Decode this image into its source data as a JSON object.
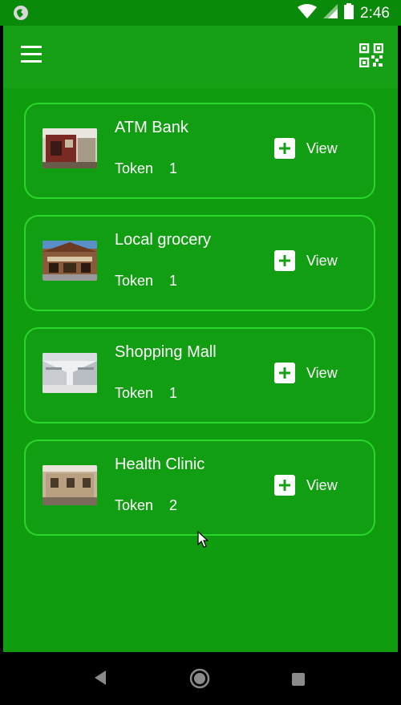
{
  "status_bar": {
    "time": "2:46"
  },
  "app_bar": {
    "menu_icon": "menu-icon",
    "scan_icon": "qr-code-scan-icon"
  },
  "places": [
    {
      "name": "ATM Bank",
      "token_label": "Token",
      "token_value": "1",
      "view_label": "View",
      "thumb_icon": "atm-bank-photo"
    },
    {
      "name": "Local grocery",
      "token_label": "Token",
      "token_value": "1",
      "view_label": "View",
      "thumb_icon": "grocery-photo"
    },
    {
      "name": "Shopping Mall",
      "token_label": "Token",
      "token_value": "1",
      "view_label": "View",
      "thumb_icon": "mall-photo"
    },
    {
      "name": "Health Clinic",
      "token_label": "Token",
      "token_value": "2",
      "view_label": "View",
      "thumb_icon": "clinic-photo"
    }
  ],
  "colors": {
    "status_bar": "#0a8a0a",
    "app_bar": "#16a016",
    "background": "#0f9d0f",
    "card_border": "#2bd62b"
  }
}
